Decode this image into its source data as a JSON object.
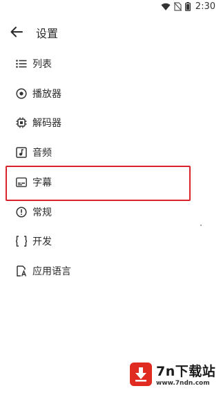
{
  "status_bar": {
    "time": "2:30",
    "icons": [
      "wifi-icon",
      "no-sim-icon",
      "battery-icon"
    ]
  },
  "toolbar": {
    "title": "设置",
    "back_icon": "arrow-back-icon"
  },
  "menu": {
    "items": [
      {
        "label": "列表",
        "icon": "list-icon"
      },
      {
        "label": "播放器",
        "icon": "player-icon"
      },
      {
        "label": "解码器",
        "icon": "decoder-chip-icon"
      },
      {
        "label": "音频",
        "icon": "audio-icon"
      },
      {
        "label": "字幕",
        "icon": "subtitles-icon",
        "highlighted": true
      },
      {
        "label": "常规",
        "icon": "info-icon"
      },
      {
        "label": "开发",
        "icon": "developer-icon"
      },
      {
        "label": "应用语言",
        "icon": "app-language-icon"
      }
    ]
  },
  "highlight_color": "#d8222a",
  "watermark": {
    "title": "7n下载站",
    "url": "www.7ndn.com",
    "color": "#e02b20"
  }
}
